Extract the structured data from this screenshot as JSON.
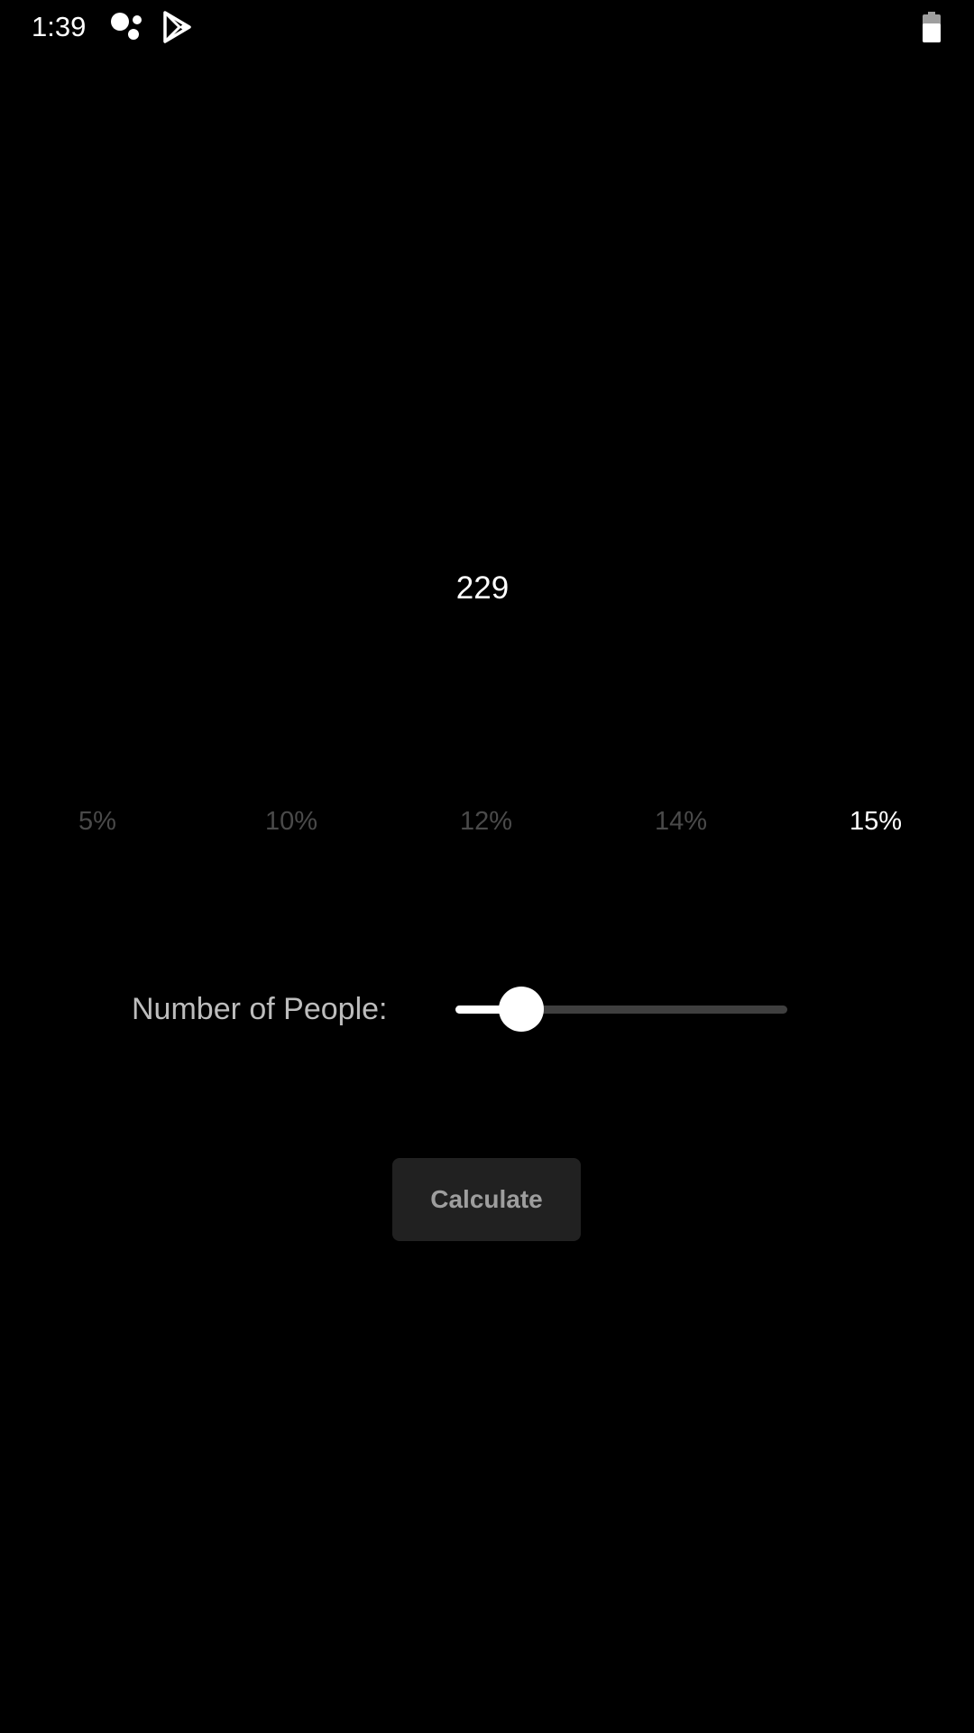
{
  "status_bar": {
    "time": "1:39",
    "icons": [
      "google-assistant-icon",
      "play-store-icon",
      "battery-icon"
    ]
  },
  "amount": "229",
  "tip_options": [
    {
      "label": "5%",
      "selected": false
    },
    {
      "label": "10%",
      "selected": false
    },
    {
      "label": "12%",
      "selected": false
    },
    {
      "label": "14%",
      "selected": false
    },
    {
      "label": "15%",
      "selected": true
    }
  ],
  "people": {
    "label": "Number of People:",
    "slider_value_fraction": 0.15
  },
  "calculate_button": {
    "label": "Calculate"
  },
  "colors": {
    "background": "#000000",
    "text_primary": "#ffffff",
    "tip_unselected": "#4a4a4a",
    "tip_selected": "#ffffff",
    "button_bg": "#212121",
    "button_text": "#9e9e9e",
    "slider_track": "#3f3f3f"
  }
}
